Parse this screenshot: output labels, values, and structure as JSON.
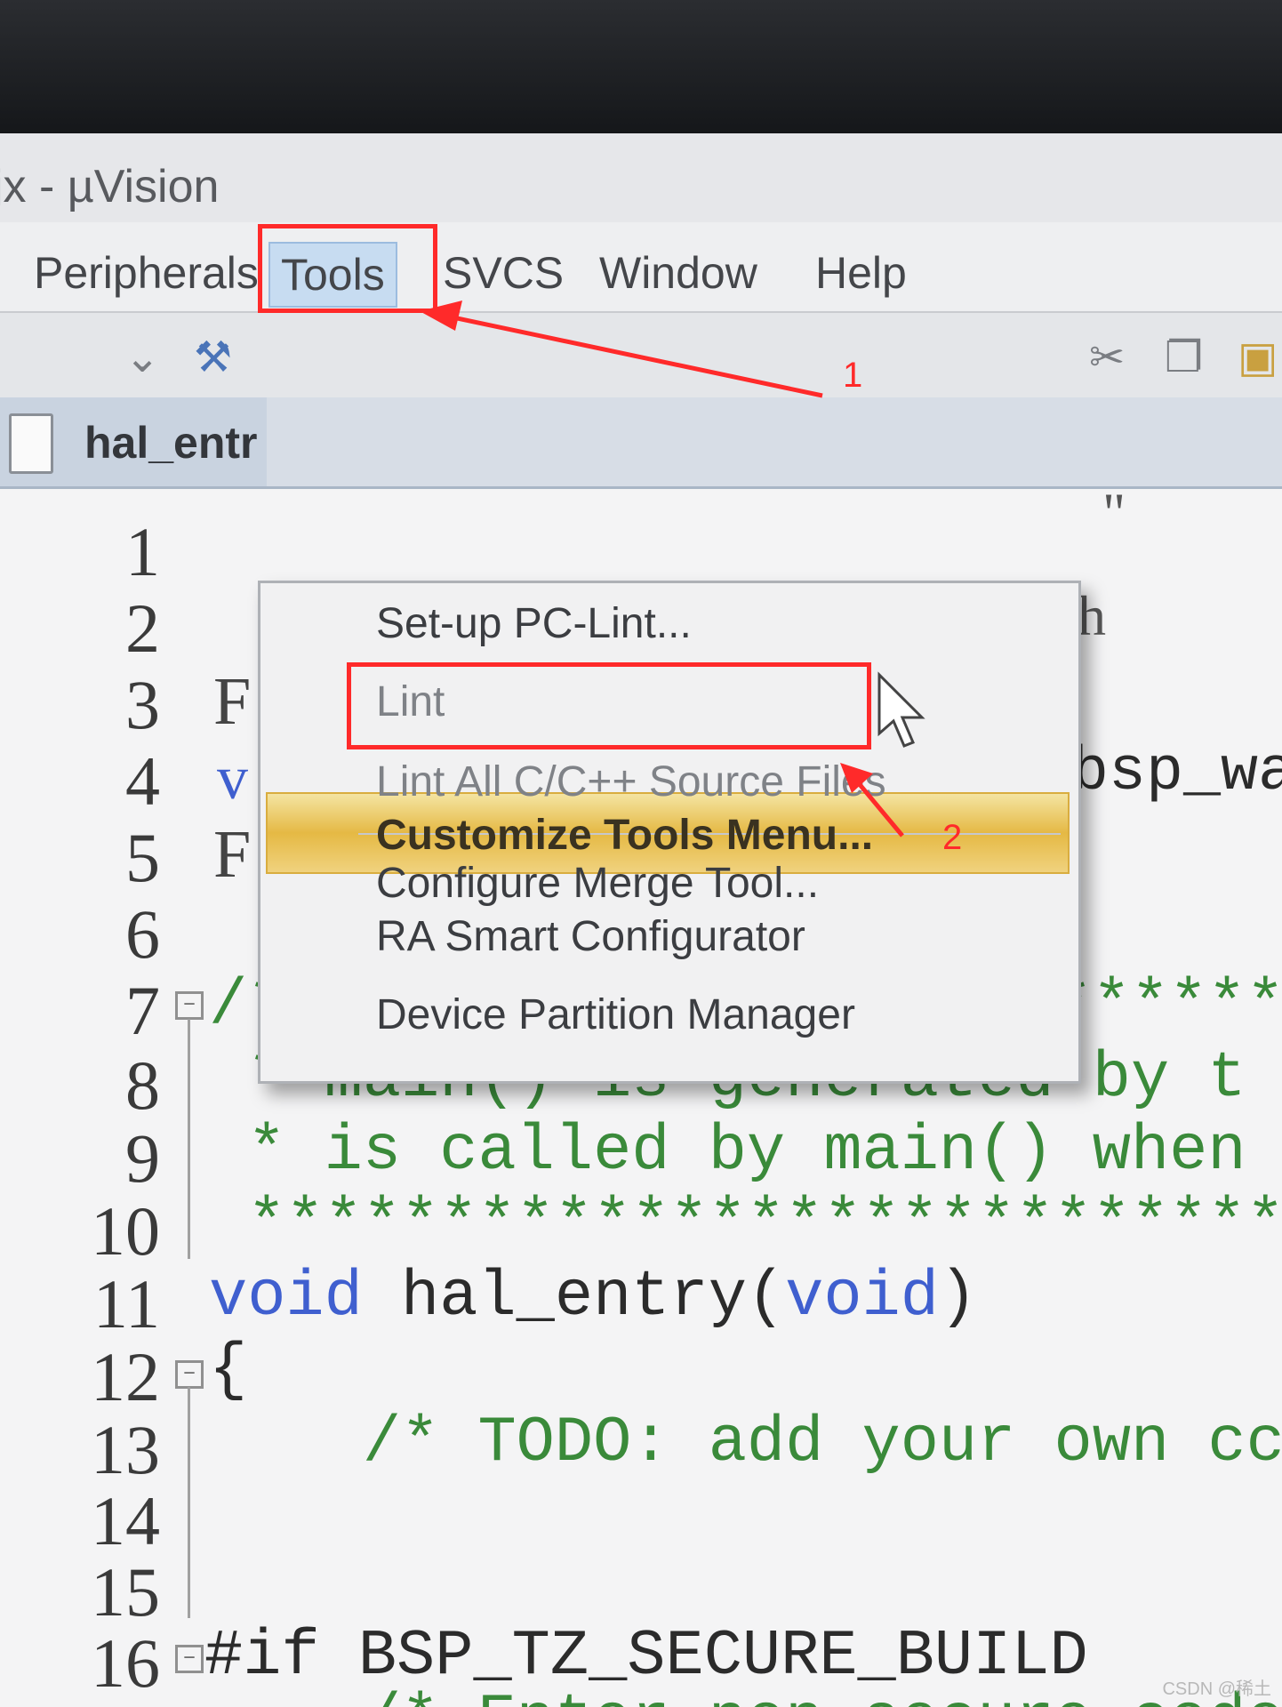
{
  "window": {
    "title": "jx - µVision"
  },
  "menu_bar": {
    "items": [
      {
        "label": "Peripherals"
      },
      {
        "label": "Tools"
      },
      {
        "label": "SVCS"
      },
      {
        "label": "Window"
      },
      {
        "label": "Help"
      }
    ]
  },
  "tab": {
    "label": "hal_entr"
  },
  "tools_menu": {
    "items": [
      {
        "label": "Set-up PC-Lint...",
        "enabled": true
      },
      {
        "label": "Lint",
        "enabled": false
      },
      {
        "label": "Lint All C/C++ Source Files",
        "enabled": false
      },
      {
        "label": "Configure Merge Tool...",
        "enabled": true
      },
      {
        "label": "Customize Tools Menu...",
        "enabled": true,
        "highlighted": true
      },
      {
        "label": "RA Smart Configurator",
        "enabled": true
      },
      {
        "label": "Device Partition Manager",
        "enabled": true
      }
    ]
  },
  "editor": {
    "line_numbers": [
      "1",
      "2",
      "3",
      "4",
      "5",
      "6",
      "7",
      "8",
      "9",
      "10",
      "11",
      "12",
      "13",
      "14",
      "15",
      "16"
    ],
    "visible_fragments": {
      "line1": "\"",
      "line2": "h",
      "line3": "F",
      "line4_left": "v",
      "line4_right": "bsp_wa",
      "line5": "F"
    },
    "code": {
      "line7": "/***************************",
      "line8": " * main() is generated by t",
      "line9": " * is called by main() when",
      "line10": " ***************************",
      "line11_kw": "void",
      "line11_name": " hal_entry(",
      "line11_arg": "void",
      "line11_end": ")",
      "line12": "{",
      "line13": "    /* TODO: add your own cc",
      "line15": "#if BSP_TZ_SECURE_BUILD",
      "line16": "    /* Enter non-secure code"
    }
  },
  "annotations": {
    "step1": "1",
    "step2": "2"
  },
  "watermark": "CSDN @稀土"
}
